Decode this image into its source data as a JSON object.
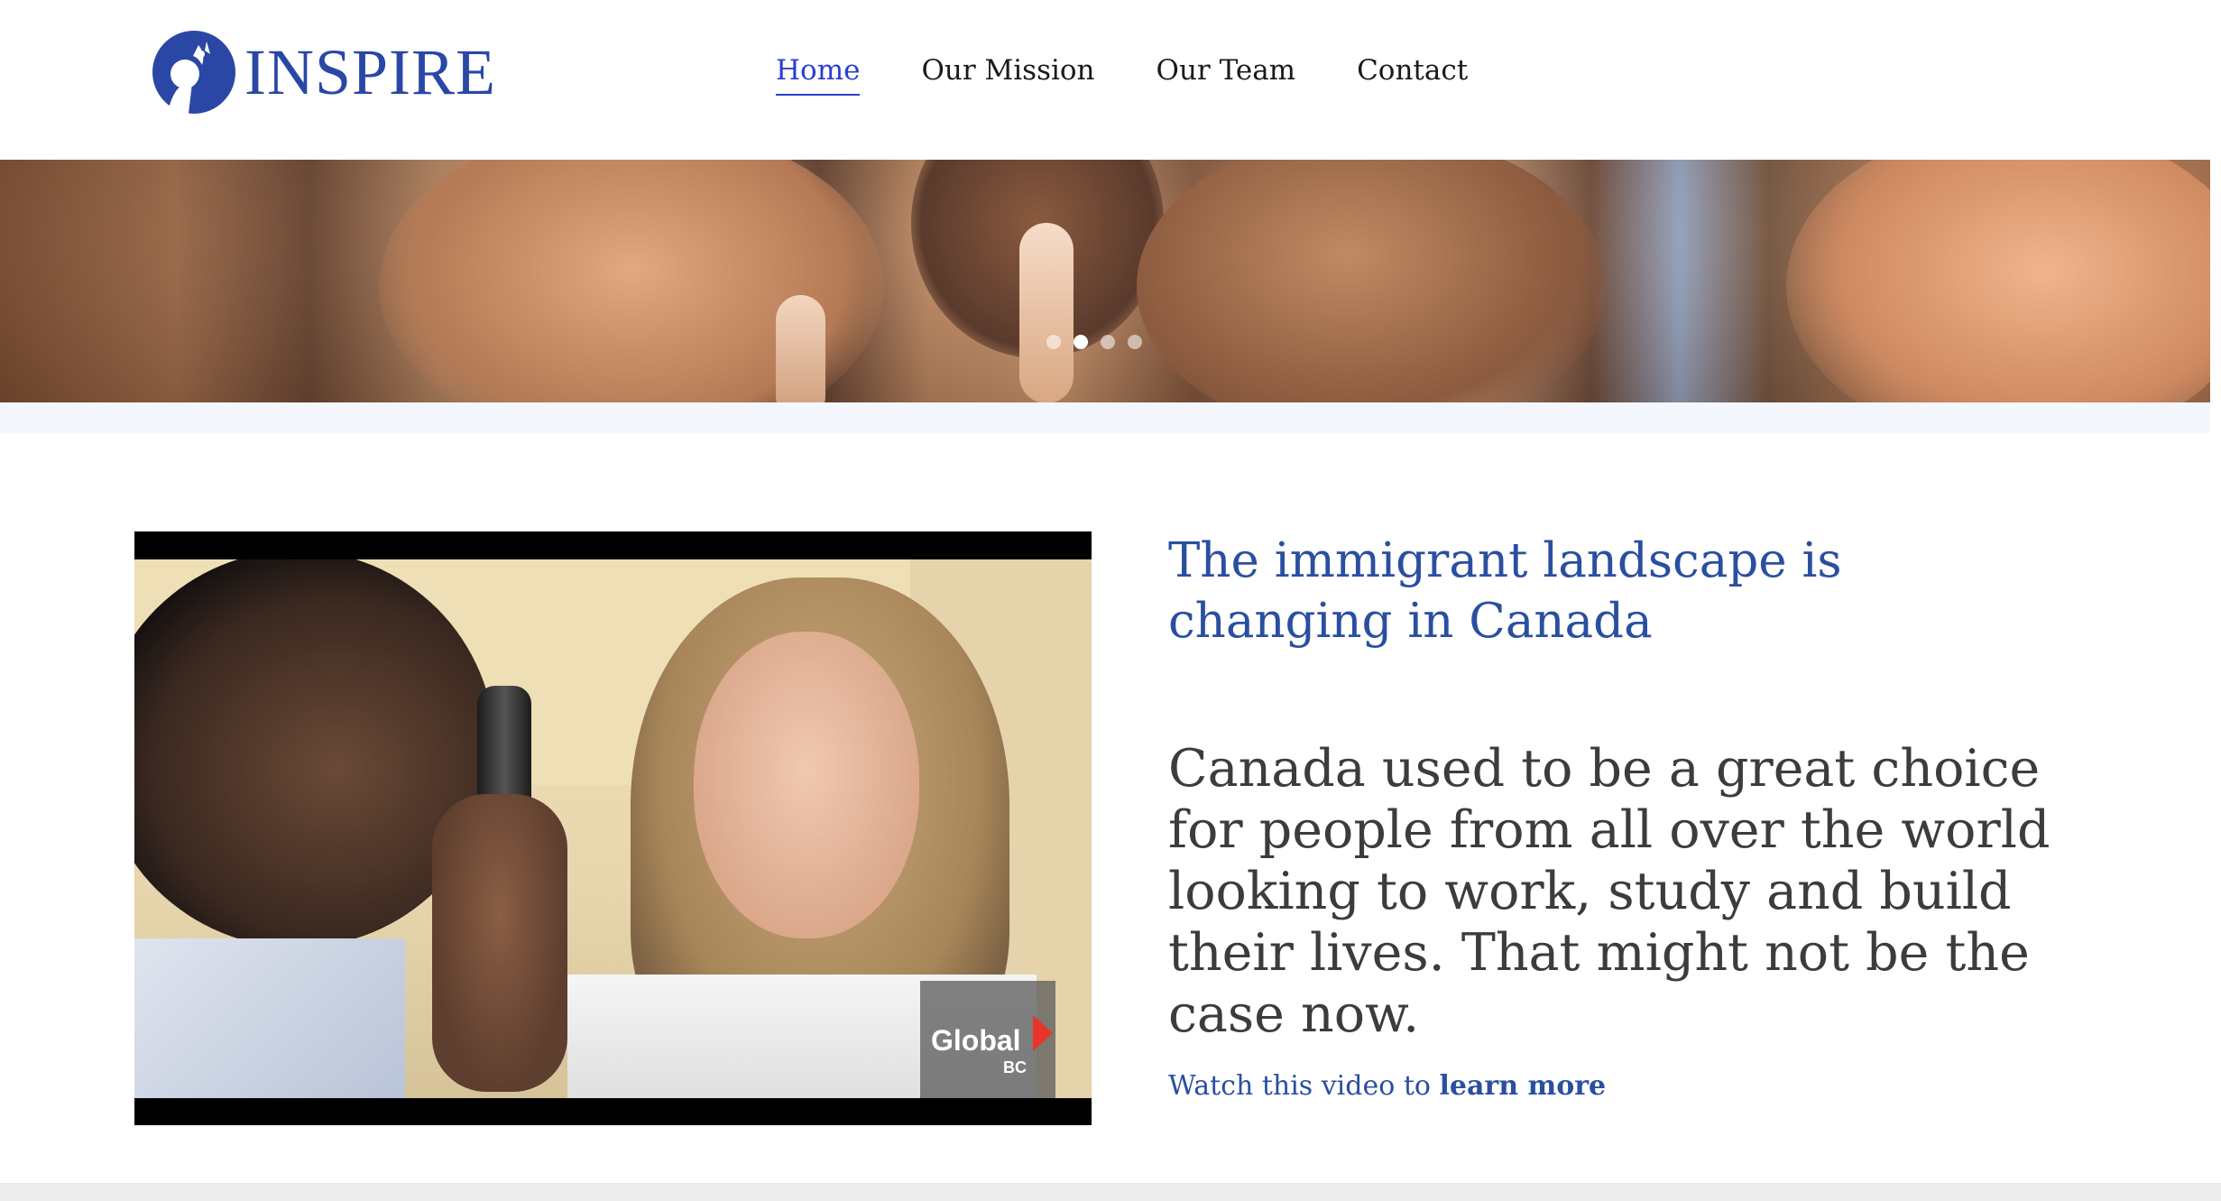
{
  "brand": {
    "name": "INSPIRE",
    "logo_icon": "inspire-circle-logo-icon",
    "color": "#2a47a6"
  },
  "nav": {
    "items": [
      {
        "label": "Home",
        "active": true
      },
      {
        "label": "Our Mission",
        "active": false
      },
      {
        "label": "Our Team",
        "active": false
      },
      {
        "label": "Contact",
        "active": false
      }
    ],
    "active_color": "#2a3fd0"
  },
  "hero": {
    "slide_count": 4,
    "active_slide": 2
  },
  "video": {
    "badge_word": "Global",
    "badge_sub": "BC"
  },
  "content": {
    "headline": "The immigrant landscape is changing in Canada",
    "body": "Canada used to be a great choice for people from all over the world looking to work, study and build their lives. That might not be the case now.",
    "watch_prefix": "Watch this video to ",
    "learn_more": "learn more",
    "accent_color": "#2a4fa0"
  }
}
